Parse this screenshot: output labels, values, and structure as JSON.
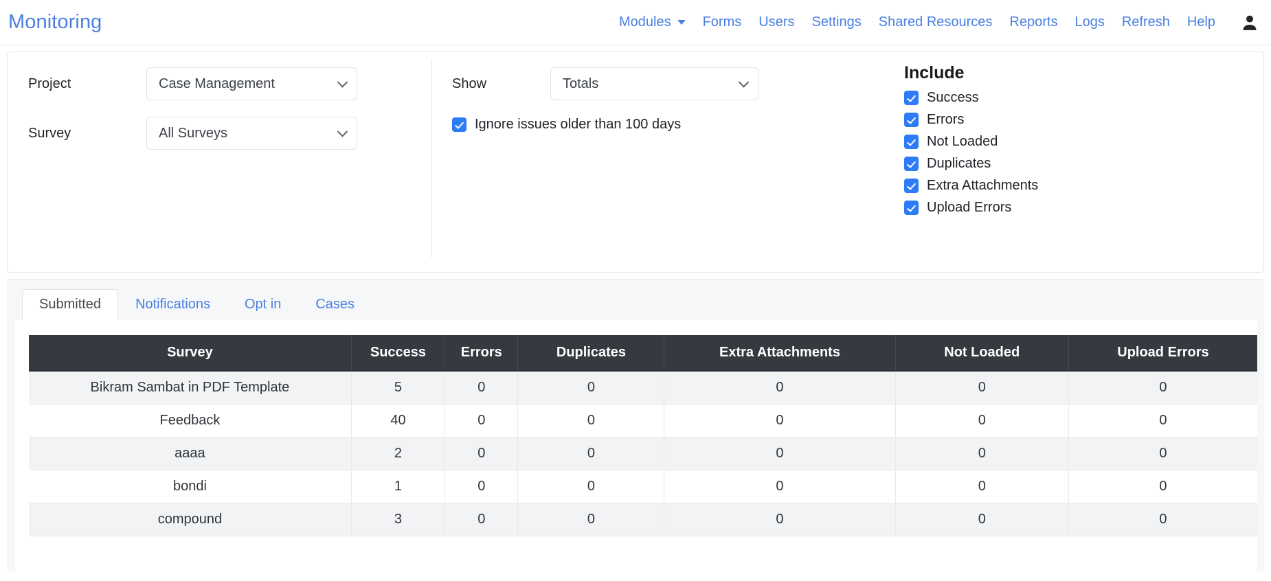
{
  "header": {
    "brand": "Monitoring",
    "nav": [
      {
        "label": "Modules",
        "dropdown": true
      },
      {
        "label": "Forms",
        "dropdown": false
      },
      {
        "label": "Users",
        "dropdown": false
      },
      {
        "label": "Settings",
        "dropdown": false
      },
      {
        "label": "Shared Resources",
        "dropdown": false
      },
      {
        "label": "Reports",
        "dropdown": false
      },
      {
        "label": "Logs",
        "dropdown": false
      },
      {
        "label": "Refresh",
        "dropdown": false
      },
      {
        "label": "Help",
        "dropdown": false
      }
    ],
    "user_icon": "user-account-icon",
    "link_color": "#4a7fe0"
  },
  "filters": {
    "project": {
      "label": "Project",
      "value": "Case Management"
    },
    "survey": {
      "label": "Survey",
      "value": "All Surveys"
    },
    "show": {
      "label": "Show",
      "value": "Totals"
    },
    "ignore": {
      "label": "Ignore issues older than 100 days",
      "checked": true
    },
    "include": {
      "title": "Include",
      "options": [
        {
          "label": "Success",
          "checked": true
        },
        {
          "label": "Errors",
          "checked": true
        },
        {
          "label": "Not Loaded",
          "checked": true
        },
        {
          "label": "Duplicates",
          "checked": true
        },
        {
          "label": "Extra Attachments",
          "checked": true
        },
        {
          "label": "Upload Errors",
          "checked": true
        }
      ]
    },
    "checkbox_color": "#2b7cf6"
  },
  "tabs": {
    "items": [
      {
        "label": "Submitted",
        "active": true
      },
      {
        "label": "Notifications",
        "active": false
      },
      {
        "label": "Opt in",
        "active": false
      },
      {
        "label": "Cases",
        "active": false
      }
    ]
  },
  "table": {
    "header_bg": "#343a40",
    "columns": [
      "Survey",
      "Success",
      "Errors",
      "Duplicates",
      "Extra Attachments",
      "Not Loaded",
      "Upload Errors"
    ],
    "rows": [
      {
        "survey": "Bikram Sambat in PDF Template",
        "success": "5",
        "errors": "0",
        "duplicates": "0",
        "extra_attachments": "0",
        "not_loaded": "0",
        "upload_errors": "0"
      },
      {
        "survey": "Feedback",
        "success": "40",
        "errors": "0",
        "duplicates": "0",
        "extra_attachments": "0",
        "not_loaded": "0",
        "upload_errors": "0"
      },
      {
        "survey": "aaaa",
        "success": "2",
        "errors": "0",
        "duplicates": "0",
        "extra_attachments": "0",
        "not_loaded": "0",
        "upload_errors": "0"
      },
      {
        "survey": "bondi",
        "success": "1",
        "errors": "0",
        "duplicates": "0",
        "extra_attachments": "0",
        "not_loaded": "0",
        "upload_errors": "0"
      },
      {
        "survey": "compound",
        "success": "3",
        "errors": "0",
        "duplicates": "0",
        "extra_attachments": "0",
        "not_loaded": "0",
        "upload_errors": "0"
      }
    ]
  }
}
